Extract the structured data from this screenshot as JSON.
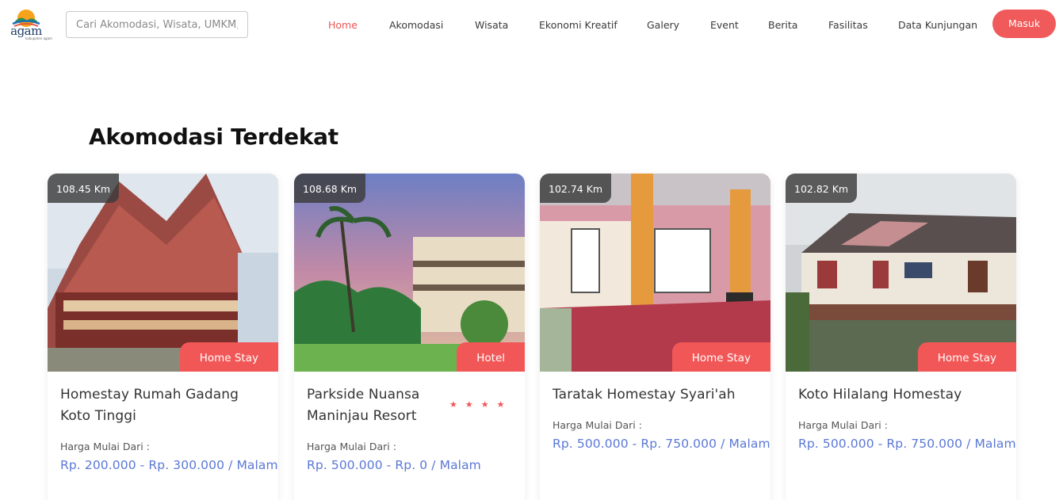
{
  "header": {
    "logo_text": "agam",
    "logo_subtext": "kabupaten agam",
    "search_placeholder": "Cari Akomodasi, Wisata, UMKM, ...",
    "nav": [
      {
        "label": "Home",
        "active": true
      },
      {
        "label": "Akomodasi",
        "active": false
      },
      {
        "label": "Wisata",
        "active": false
      },
      {
        "label": "Ekonomi Kreatif",
        "active": false
      },
      {
        "label": "Galery",
        "active": false
      },
      {
        "label": "Event",
        "active": false
      },
      {
        "label": "Berita",
        "active": false
      },
      {
        "label": "Fasilitas",
        "active": false
      },
      {
        "label": "Data Kunjungan",
        "active": false
      }
    ],
    "login_label": "Masuk"
  },
  "section": {
    "title": "Akomodasi Terdekat",
    "cards": [
      {
        "distance": "108.45 Km",
        "type": "Home Stay",
        "title": "Homestay Rumah Gadang Koto Tinggi",
        "stars": "",
        "price_label": "Harga Mulai Dari :",
        "price": "Rp. 200.000 - Rp. 300.000 / Malam"
      },
      {
        "distance": "108.68 Km",
        "type": "Hotel",
        "title": "Parkside Nuansa Maninjau Resort",
        "stars": "★★★★",
        "price_label": "Harga Mulai Dari :",
        "price": "Rp. 500.000 - Rp. 0 / Malam"
      },
      {
        "distance": "102.74 Km",
        "type": "Home Stay",
        "title": "Taratak Homestay Syari'ah",
        "stars": "",
        "price_label": "Harga Mulai Dari :",
        "price": "Rp. 500.000 - Rp. 750.000 / Malam"
      },
      {
        "distance": "102.82 Km",
        "type": "Home Stay",
        "title": "Koto Hilalang Homestay",
        "stars": "",
        "price_label": "Harga Mulai Dari :",
        "price": "Rp. 500.000 - Rp. 750.000 / Malam"
      }
    ]
  },
  "colors": {
    "accent": "#f05454",
    "price": "#5b78d6",
    "distance_bg": "#3c3c3c"
  }
}
